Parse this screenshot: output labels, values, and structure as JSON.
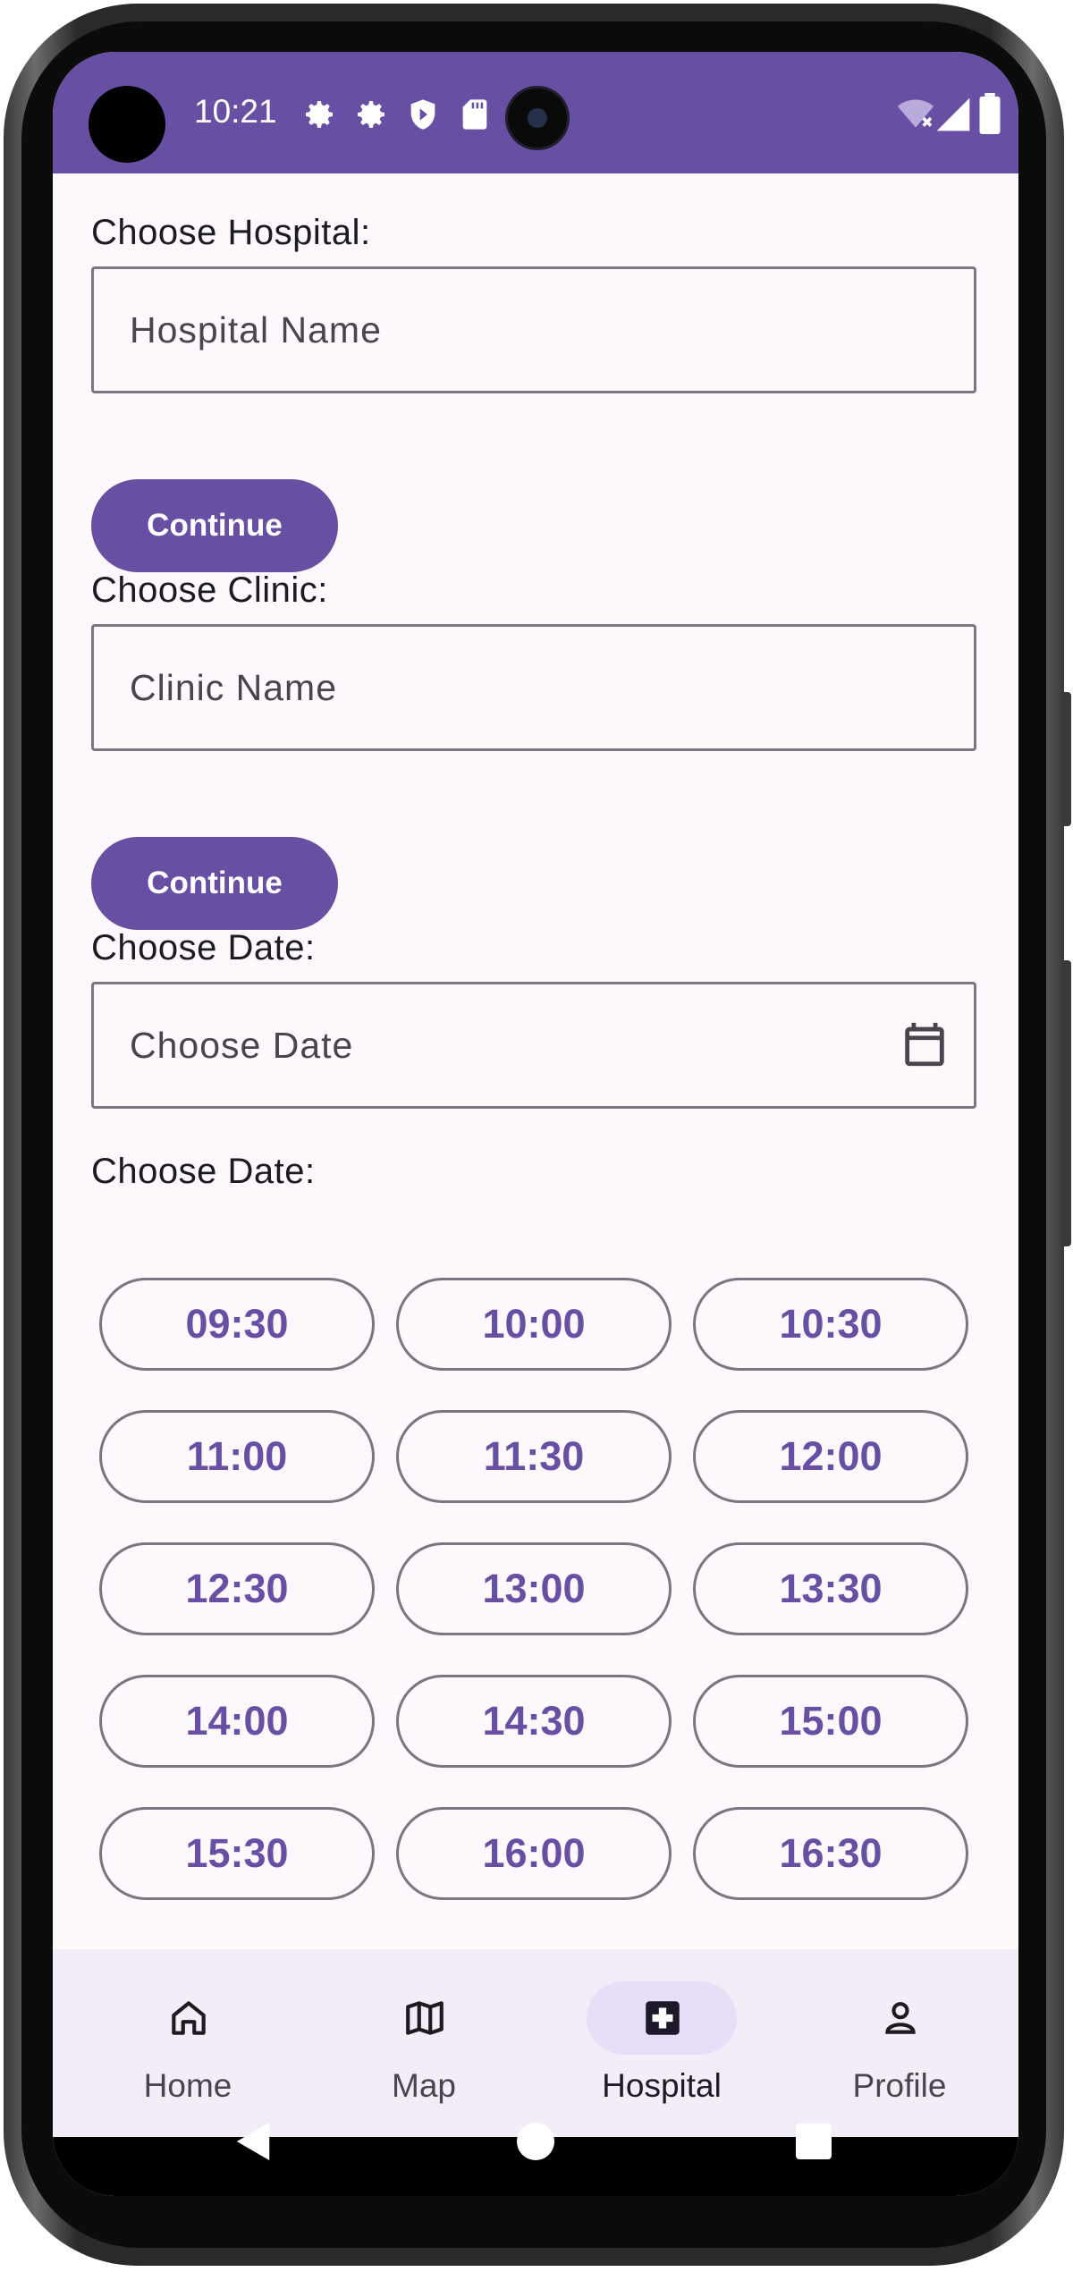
{
  "status_bar": {
    "time": "10:21",
    "icons": [
      "settings-icon",
      "settings-icon",
      "shield-icon",
      "sd-card-icon",
      "wifi-off-icon",
      "signal-icon",
      "battery-icon"
    ],
    "color": "#6750a4"
  },
  "form": {
    "hospital": {
      "label": "Choose Hospital:",
      "placeholder": "Hospital Name",
      "button": "Continue"
    },
    "clinic": {
      "label": "Choose Clinic:",
      "placeholder": "Clinic Name",
      "button": "Continue"
    },
    "date": {
      "label": "Choose Date:",
      "placeholder": "Choose Date",
      "icon": "calendar-icon"
    },
    "time": {
      "label": "Choose Date:",
      "slots": [
        "09:30",
        "10:00",
        "10:30",
        "11:00",
        "11:30",
        "12:00",
        "12:30",
        "13:00",
        "13:30",
        "14:00",
        "14:30",
        "15:00",
        "15:30",
        "16:00",
        "16:30"
      ]
    }
  },
  "bottom_nav": {
    "items": [
      {
        "label": "Home",
        "icon": "home-icon",
        "active": false
      },
      {
        "label": "Map",
        "icon": "map-icon",
        "active": false
      },
      {
        "label": "Hospital",
        "icon": "hospital-icon",
        "active": true
      },
      {
        "label": "Profile",
        "icon": "profile-icon",
        "active": false
      }
    ]
  },
  "colors": {
    "primary": "#6750a4",
    "surface": "#fdf8fc",
    "nav_background": "#f3edf7",
    "active_indicator": "#e8def8"
  }
}
